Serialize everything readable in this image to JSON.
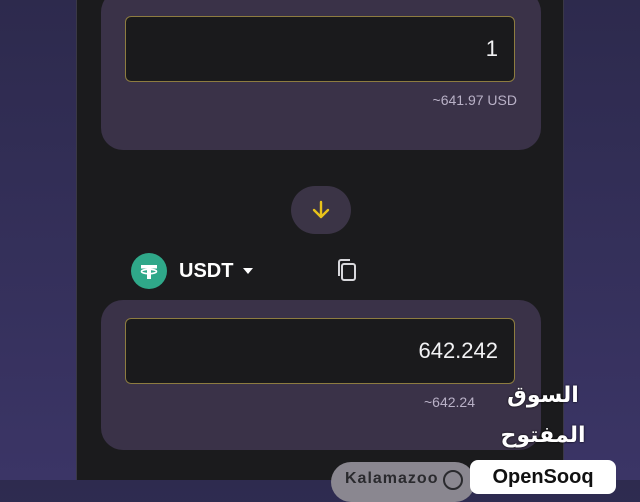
{
  "from": {
    "amount": "1",
    "usd_estimate": "~641.97 USD"
  },
  "swap": {
    "icon": "arrow-down-icon",
    "accent": "#e8c21a"
  },
  "to": {
    "token": "USDT",
    "token_icon": "tether-icon",
    "copy_icon": "copy-icon",
    "amount": "642.242",
    "usd_estimate": "~642.24"
  },
  "footer": {
    "pill_label": "Kalamazoo"
  },
  "watermark": {
    "arabic": "السوق المفتوح",
    "brand": "OpenSooq"
  },
  "colors": {
    "background": "#2e2b4f",
    "panel": "#1b1b1d",
    "card": "#3a3248",
    "field_border": "#8d7c40",
    "token_green": "#2fa889"
  }
}
